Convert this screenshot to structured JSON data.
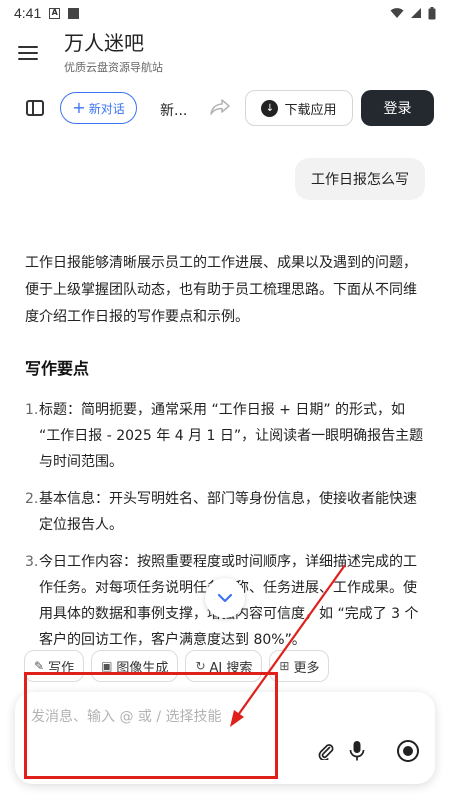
{
  "status_bar": {
    "time": "4:41",
    "icon_a": "A"
  },
  "header": {
    "title": "万人迷吧",
    "subtitle": "优质云盘资源导航站"
  },
  "toolbar": {
    "new_chat_label": "新对话",
    "conversation_title": "新...",
    "download_label": "下载应用",
    "login_label": "登录"
  },
  "user_message": "工作日报怎么写",
  "answer": {
    "intro": "工作日报能够清晰展示员工的工作进展、成果以及遇到的问题，便于上级掌握团队动态，也有助于员工梳理思路。下面从不同维度介绍工作日报的写作要点和示例。",
    "section_title": "写作要点",
    "points": [
      {
        "num": "1.",
        "text": "标题：简明扼要，通常采用 “工作日报 + 日期” 的形式，如 “工作日报 - 2025 年 4 月 1 日”，让阅读者一眼明确报告主题与时间范围。"
      },
      {
        "num": "2.",
        "text": "基本信息：开头写明姓名、部门等身份信息，使接收者能快速定位报告人。"
      },
      {
        "num": "3.",
        "text": "今日工作内容：按照重要程度或时间顺序，详细描述完成的工作任务。对每项任务说明任务名称、任务进展、工作成果。使用具体的数据和事例支撑，增强内容可信度，如 “完成了 3 个客户的回访工作，客户满意度达到 80%”。"
      }
    ]
  },
  "skills": [
    {
      "label": "写作",
      "icon": "pen-icon",
      "glyph": "✎"
    },
    {
      "label": "图像生成",
      "icon": "image-icon",
      "glyph": "▣"
    },
    {
      "label": "AI 搜索",
      "icon": "refresh-search-icon",
      "glyph": "↻"
    },
    {
      "label": "更多",
      "icon": "grid-icon",
      "glyph": "⊞"
    }
  ],
  "input": {
    "placeholder": "发消息、输入 @ 或 / 选择技能"
  },
  "colors": {
    "accent": "#3b73f0",
    "login_bg": "#24292f",
    "annotation": "#e0201b"
  }
}
